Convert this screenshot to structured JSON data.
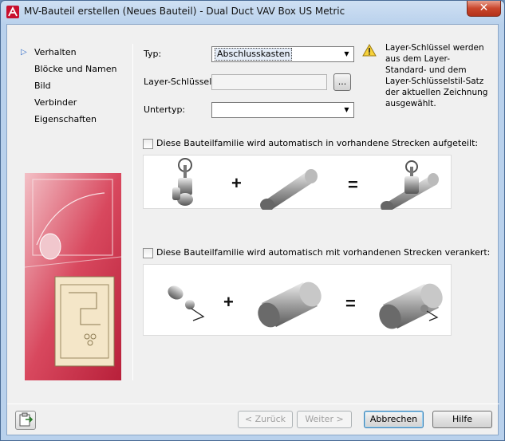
{
  "window": {
    "title": "MV-Bauteil erstellen (Neues Bauteil) - Dual Duct VAV Box US Metric",
    "close_label": "✕"
  },
  "nav": {
    "items": [
      {
        "label": "Verhalten",
        "selected": true
      },
      {
        "label": "Blöcke und Namen"
      },
      {
        "label": "Bild"
      },
      {
        "label": "Verbinder"
      },
      {
        "label": "Eigenschaften"
      }
    ]
  },
  "form": {
    "typ_label": "Typ:",
    "typ_value": "Abschlusskasten",
    "layer_label": "Layer-Schlüssel:",
    "layer_value": "",
    "browse_label": "...",
    "untertyp_label": "Untertyp:",
    "untertyp_value": ""
  },
  "warning": {
    "icon": "warning-triangle-icon",
    "text": "Layer-Schlüssel werden aus dem Layer-Standard- und dem Layer-Schlüsselstil-Satz der aktuellen Zeichnung ausgewählt."
  },
  "options": {
    "split_label": "Diese Bauteilfamilie wird automatisch in vorhandene Strecken aufgeteilt:",
    "split_checked": false,
    "anchor_label": "Diese Bauteilfamilie wird automatisch mit vorhandenen Strecken verankert:",
    "anchor_checked": false
  },
  "illustration": {
    "plus": "+",
    "equals": "="
  },
  "footer": {
    "back_label": "< Zurück",
    "next_label": "Weiter >",
    "cancel_label": "Abbrechen",
    "help_label": "Hilfe"
  },
  "colors": {
    "accent": "#2a68c8",
    "art_red": "#c8344a",
    "close_red": "#c9462c"
  }
}
